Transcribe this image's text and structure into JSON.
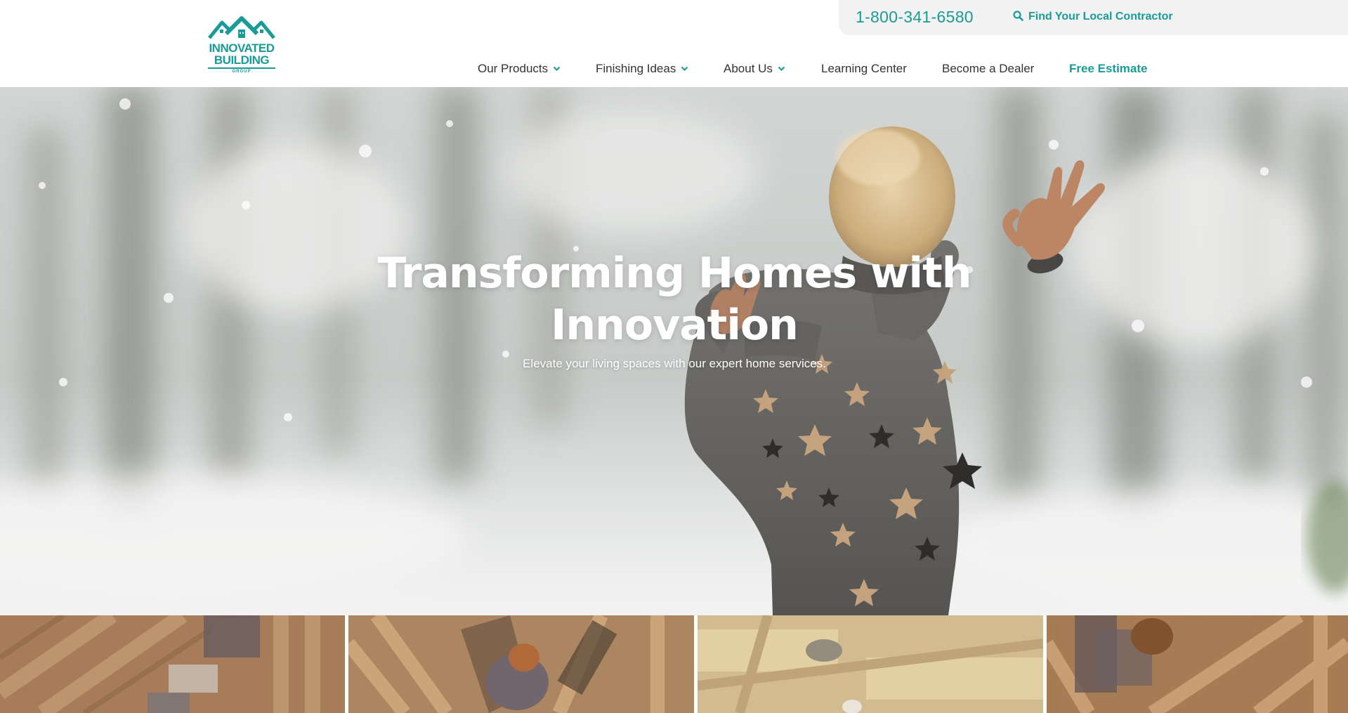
{
  "header": {
    "logo": {
      "line1": "INNOVATED",
      "line2": "BUILDING",
      "line3": "GROUP"
    },
    "phone": "1-800-341-6580",
    "contractor_link": "Find Your Local Contractor",
    "nav": [
      {
        "label": "Our Products",
        "dropdown": true
      },
      {
        "label": "Finishing Ideas",
        "dropdown": true
      },
      {
        "label": "About Us",
        "dropdown": true
      },
      {
        "label": "Learning Center",
        "dropdown": false
      },
      {
        "label": "Become a Dealer",
        "dropdown": false
      },
      {
        "label": "Free Estimate",
        "dropdown": false
      }
    ],
    "icons": {
      "search": "search-icon",
      "dropdown": "chevron-down-icon",
      "logo": "house-roof-logo"
    }
  },
  "hero": {
    "title_line1": "Transforming Homes with",
    "title_line2": "Innovation",
    "subtitle": "Elevate your living spaces with our expert home services."
  },
  "colors": {
    "accent": "#1a9b98",
    "nav_text": "#333333",
    "topbar_bg": "#f2f2f2"
  }
}
